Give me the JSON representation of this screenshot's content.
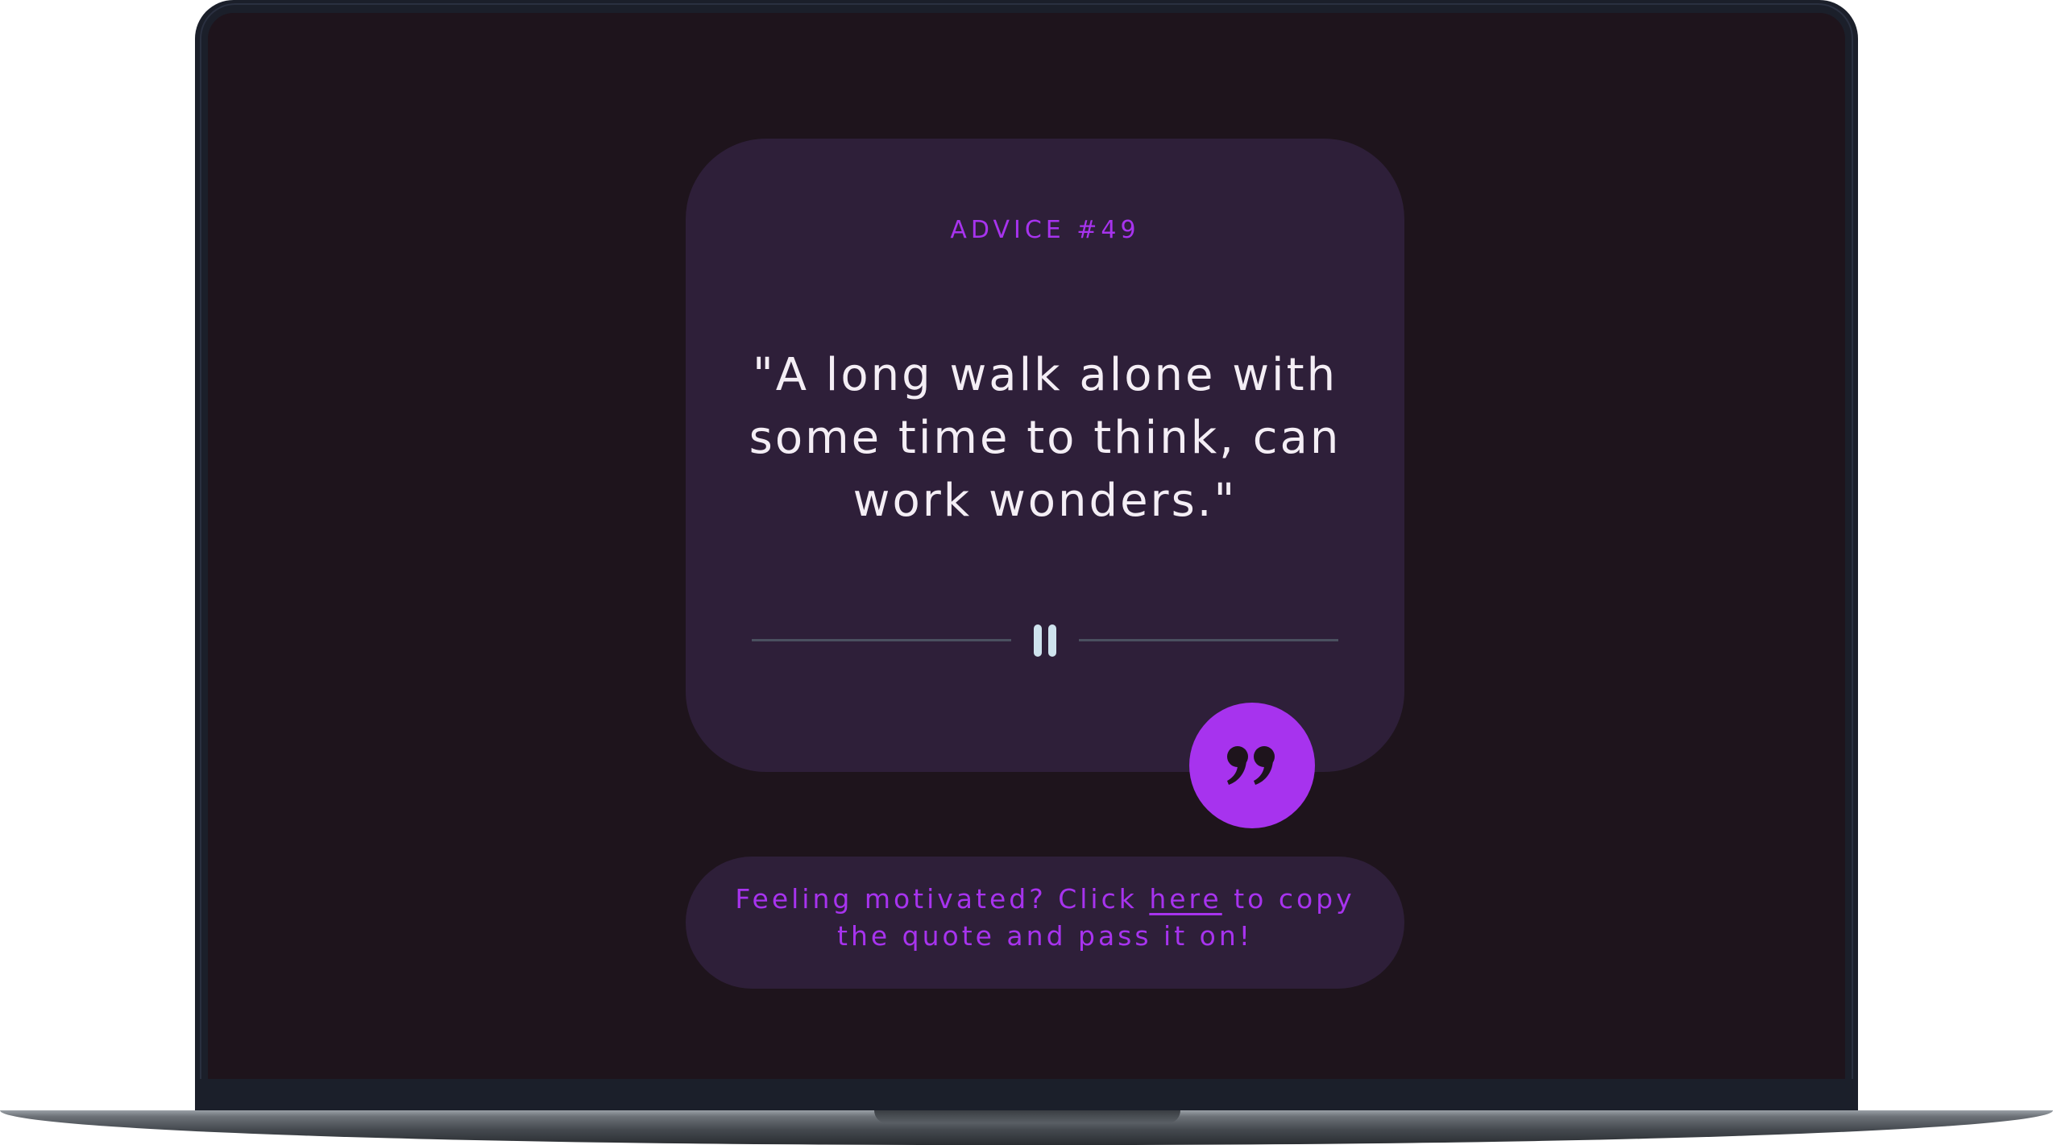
{
  "advice": {
    "id_label": "ADVICE #49",
    "quote": "\"A long walk alone with some time to think, can work wonders.\""
  },
  "divider": {
    "icon": "pause-icon"
  },
  "button": {
    "icon": "quote-marks-icon"
  },
  "footer": {
    "text_before": "Feeling motivated? Click ",
    "link_text": "here",
    "text_after": " to copy the quote and pass it on!"
  },
  "colors": {
    "accent": "#a733ee",
    "card_bg": "#2e1f39",
    "screen_bg": "#1e141c",
    "quote_text": "#f4eef5",
    "divider": "#4a5060"
  }
}
